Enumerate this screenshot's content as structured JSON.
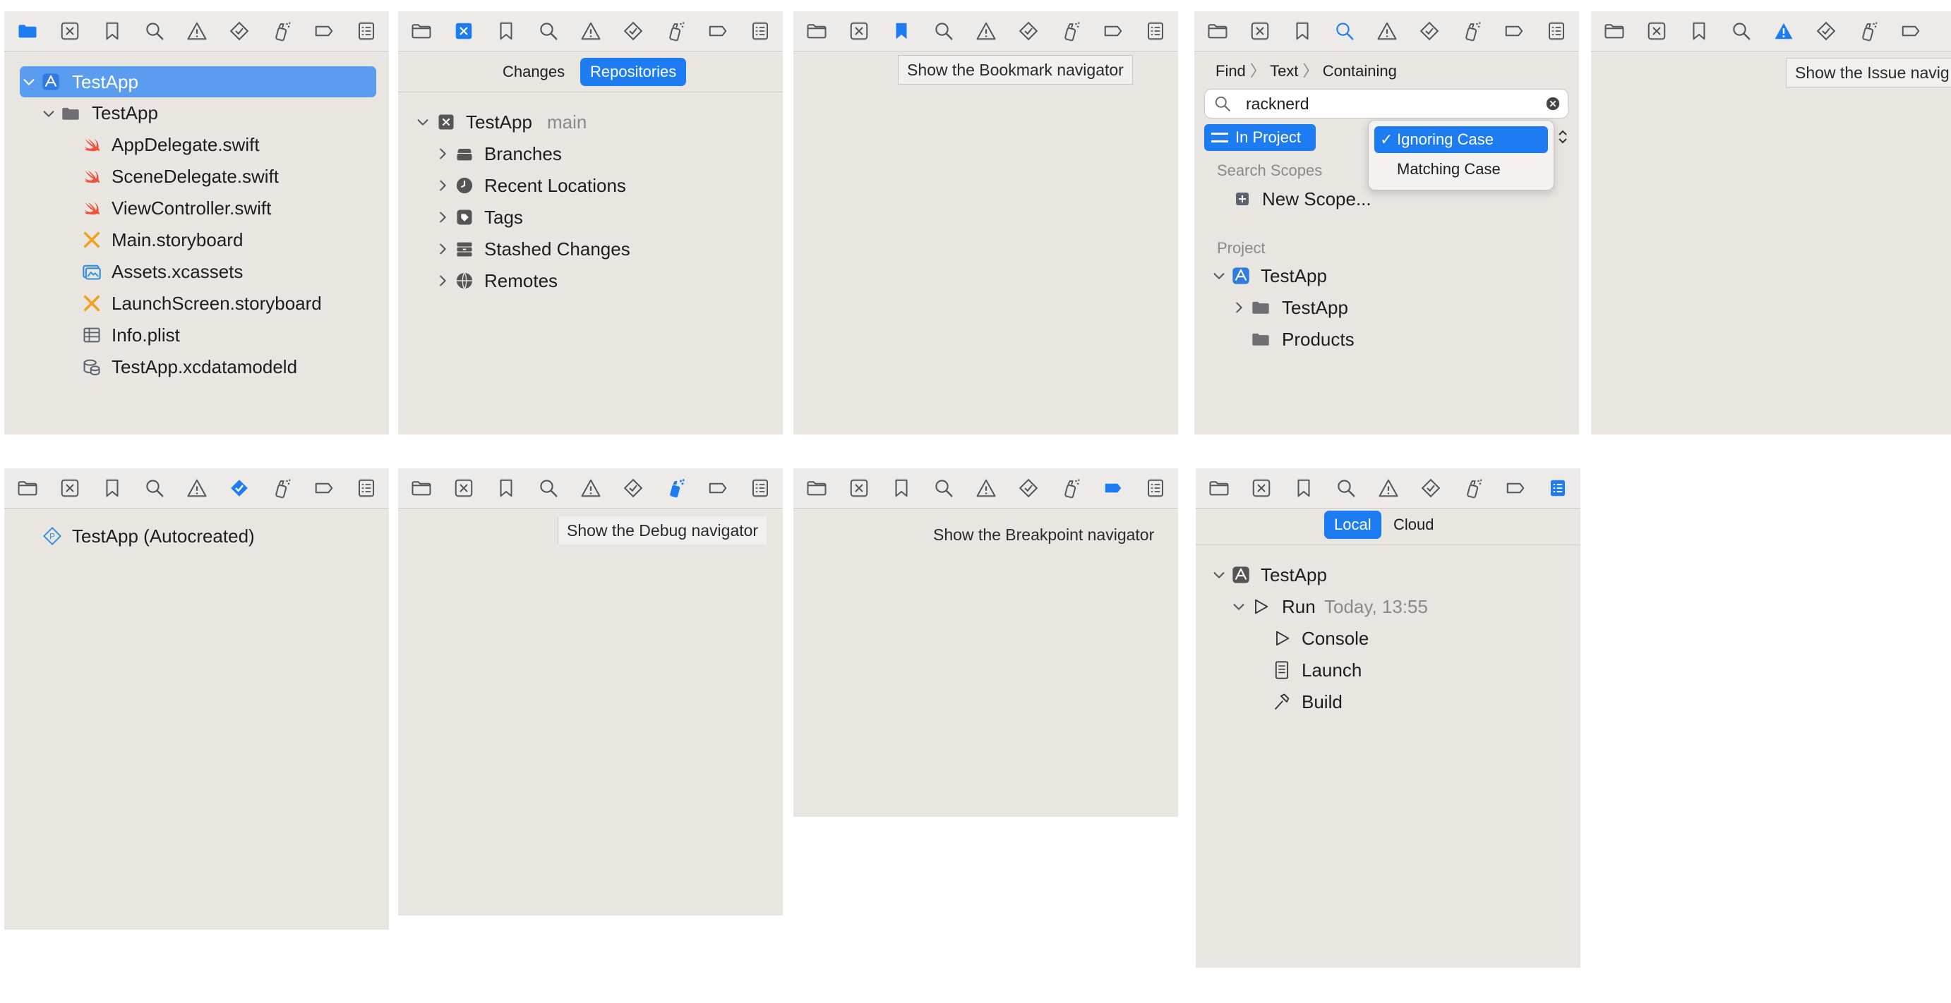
{
  "colors": {
    "accent": "#1e7cf2",
    "swift": "#f05138",
    "storyboard": "#f0a21b",
    "assets": "#2f8de0"
  },
  "toolbar_icons": [
    "folder-icon",
    "source-control-icon",
    "bookmark-icon",
    "search-icon",
    "warning-icon",
    "test-diamond-icon",
    "debug-spray-icon",
    "breakpoint-icon",
    "report-icon"
  ],
  "project_nav": {
    "root": "TestApp",
    "group": "TestApp",
    "files": [
      {
        "name": "AppDelegate.swift",
        "icon": "swift-icon"
      },
      {
        "name": "SceneDelegate.swift",
        "icon": "swift-icon"
      },
      {
        "name": "ViewController.swift",
        "icon": "swift-icon"
      },
      {
        "name": "Main.storyboard",
        "icon": "storyboard-icon"
      },
      {
        "name": "Assets.xcassets",
        "icon": "assets-icon"
      },
      {
        "name": "LaunchScreen.storyboard",
        "icon": "storyboard-icon"
      },
      {
        "name": "Info.plist",
        "icon": "plist-icon"
      },
      {
        "name": "TestApp.xcdatamodeld",
        "icon": "datamodel-icon"
      }
    ]
  },
  "source_control_nav": {
    "tabs": [
      "Changes",
      "Repositories"
    ],
    "repo_name": "TestApp",
    "branch": "main",
    "items": [
      "Branches",
      "Recent Locations",
      "Tags",
      "Stashed Changes",
      "Remotes"
    ]
  },
  "bookmark_nav": {
    "tooltip": "Show the Bookmark navigator"
  },
  "find_nav": {
    "breadcrumb": [
      "Find",
      "Text",
      "Containing"
    ],
    "query": "racknerd",
    "scope_button": "In Project",
    "menu": [
      "Ignoring Case",
      "Matching Case"
    ],
    "menu_checked": "✓",
    "scopes_header": "Search Scopes",
    "new_scope": "New Scope...",
    "project_header": "Project",
    "project": "TestApp",
    "children": [
      "TestApp",
      "Products"
    ]
  },
  "issue_nav": {
    "tooltip": "Show the Issue navig"
  },
  "test_nav": {
    "item": "TestApp (Autocreated)"
  },
  "debug_nav": {
    "tooltip": "Show the Debug navigator"
  },
  "breakpoint_nav": {
    "tooltip": "Show the Breakpoint navigator"
  },
  "report_nav": {
    "tabs": [
      "Local",
      "Cloud"
    ],
    "project": "TestApp",
    "run_label": "Run",
    "run_time": "Today, 13:55",
    "children": [
      "Console",
      "Launch",
      "Build"
    ]
  }
}
